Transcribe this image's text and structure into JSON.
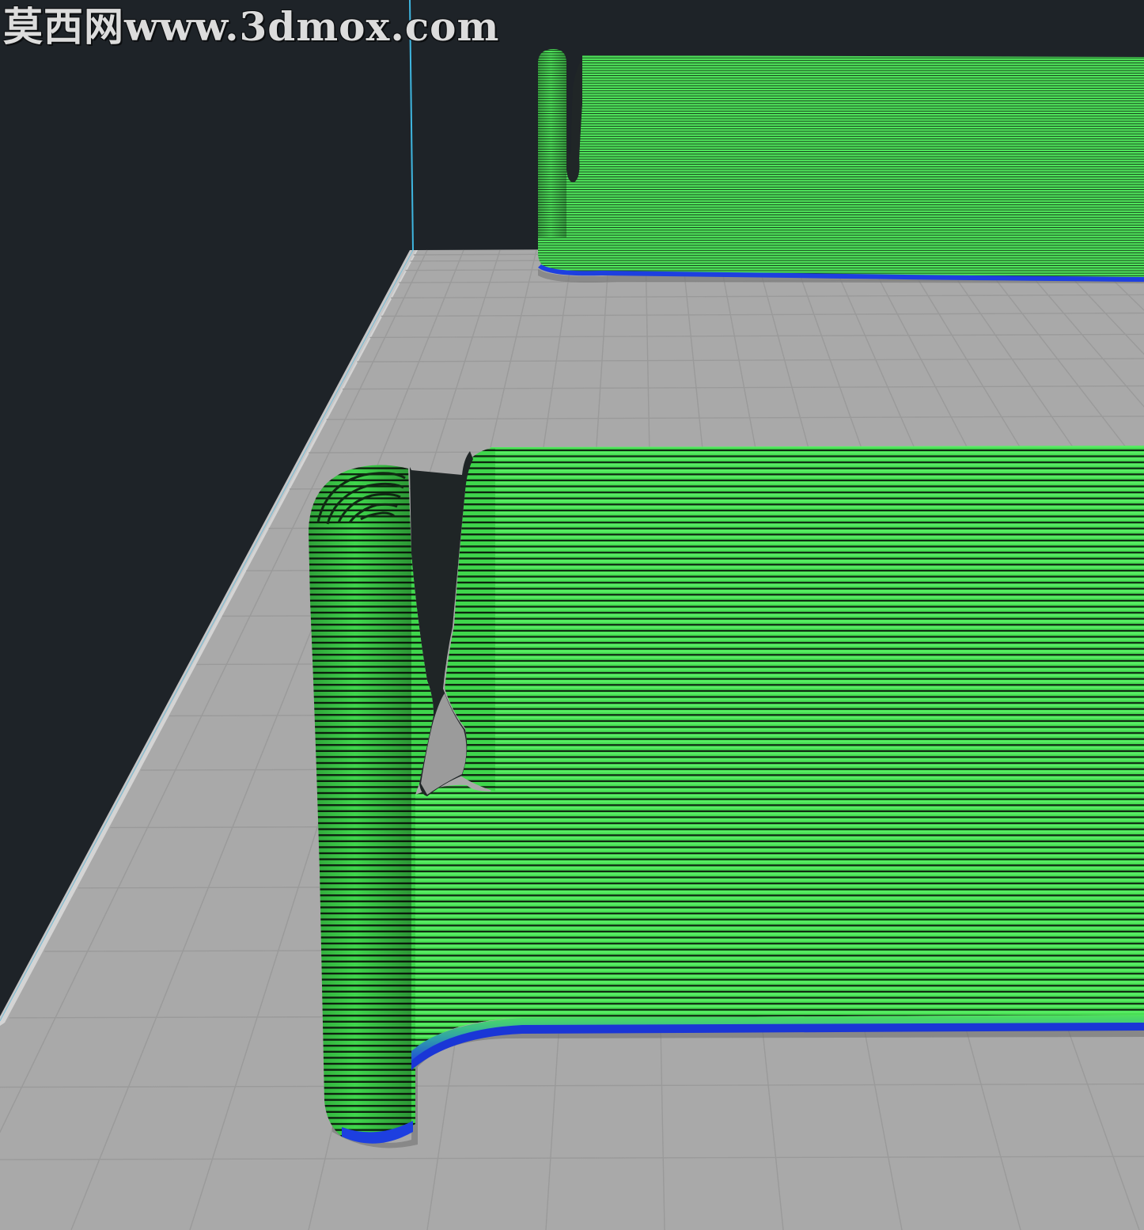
{
  "viewer": {
    "watermark_text": "莫西网www.3dmox.com"
  },
  "scene": {
    "view": "layer-preview",
    "object_count": 2,
    "colors": {
      "background": "#1e2328",
      "build_plate": "#a9a9a9",
      "plate_grid": "#9b9b9b",
      "volume_edge": "#3fb6e0",
      "extrusion_green": "#4ee65a",
      "extrusion_dark": "#0f2c12",
      "first_layer_blue": "#1d3fe0",
      "teal_transition": "#2fa2a8"
    }
  }
}
